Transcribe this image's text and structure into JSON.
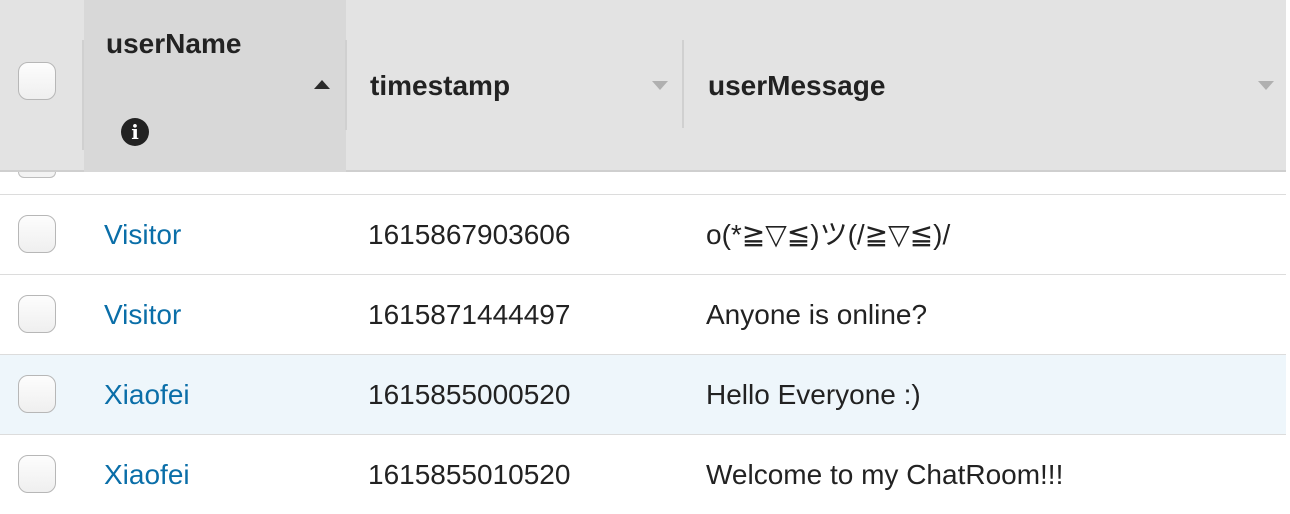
{
  "header": {
    "columns": {
      "username": "userName",
      "timestamp": "timestamp",
      "message": "userMessage"
    },
    "icons": {
      "sort": "sort-ascending-icon",
      "info": "info-icon",
      "info_glyph": "i"
    }
  },
  "rows": [
    {
      "user": "Visitor",
      "timestamp": "1615867903606",
      "message": "o(*≧▽≦)ツ(/≧▽≦)/"
    },
    {
      "user": "Visitor",
      "timestamp": "1615871444497",
      "message": "Anyone is online?"
    },
    {
      "user": "Xiaofei",
      "timestamp": "1615855000520",
      "message": "Hello Everyone :)"
    },
    {
      "user": "Xiaofei",
      "timestamp": "1615855010520",
      "message": "Welcome to my ChatRoom!!!"
    }
  ],
  "colors": {
    "link": "#0a6ea8",
    "highlight_row": "#eef6fb",
    "header_bg": "#e3e3e3"
  }
}
